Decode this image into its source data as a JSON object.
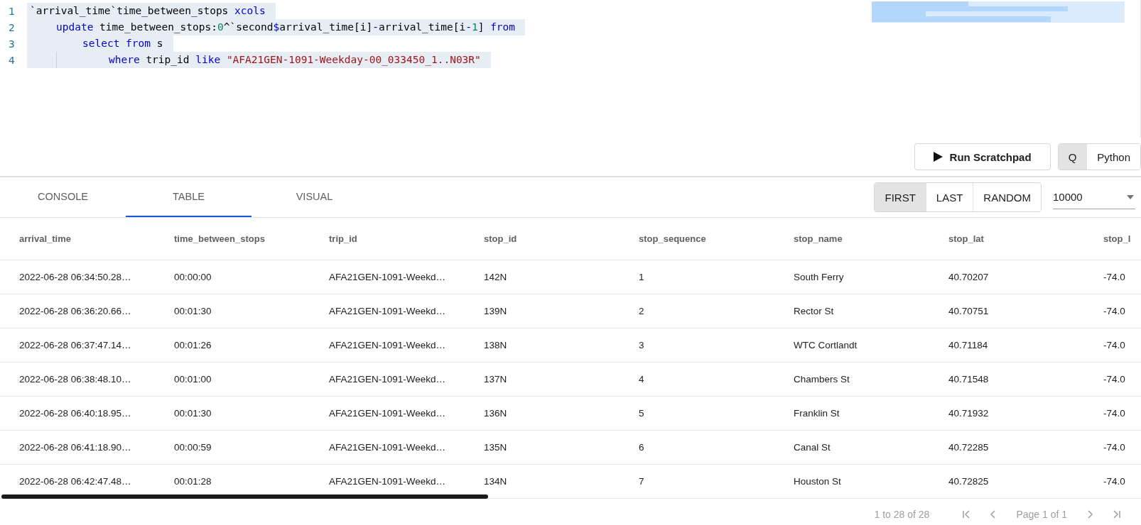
{
  "editor": {
    "lines": [
      {
        "number": "1",
        "tokens": [
          {
            "kind": "plain",
            "text": "`arrival_time`time_between_stops "
          },
          {
            "kind": "keyword",
            "text": "xcols"
          }
        ],
        "children": [
          {
            "number": "2",
            "tokens": [
              {
                "kind": "keyword",
                "text": "update "
              },
              {
                "kind": "plain",
                "text": "time_between_stops:"
              },
              {
                "kind": "number",
                "text": "0"
              },
              {
                "kind": "plain",
                "text": "^`second"
              },
              {
                "kind": "keyword",
                "text": "$"
              },
              {
                "kind": "plain",
                "text": "arrival_time[i]"
              },
              {
                "kind": "keyword",
                "text": "-"
              },
              {
                "kind": "plain",
                "text": "arrival_time[i"
              },
              {
                "kind": "keyword",
                "text": "-"
              },
              {
                "kind": "number",
                "text": "1"
              },
              {
                "kind": "plain",
                "text": "] "
              },
              {
                "kind": "keyword",
                "text": "from"
              }
            ],
            "children": [
              {
                "number": "3",
                "tokens": [
                  {
                    "kind": "keyword",
                    "text": "select from "
                  },
                  {
                    "kind": "plain",
                    "text": "s"
                  }
                ],
                "children": [
                  {
                    "number": "4",
                    "tokens": [
                      {
                        "kind": "keyword",
                        "text": "where "
                      },
                      {
                        "kind": "plain",
                        "text": "trip_id "
                      },
                      {
                        "kind": "keyword",
                        "text": "like "
                      },
                      {
                        "kind": "string",
                        "text": "\"AFA21GEN-1091-Weekday-00_033450_1..N03R\""
                      }
                    ]
                  }
                ]
              }
            ]
          }
        ]
      }
    ]
  },
  "run_button": {
    "label": "Run Scratchpad"
  },
  "languages": [
    {
      "label": "Q",
      "selected": true
    },
    {
      "label": "Python",
      "selected": false
    }
  ],
  "tabs": [
    {
      "label": "CONSOLE",
      "selected": false
    },
    {
      "label": "TABLE",
      "selected": true
    },
    {
      "label": "VISUAL",
      "selected": false
    }
  ],
  "sample_modes": [
    {
      "label": "FIRST",
      "selected": true
    },
    {
      "label": "LAST",
      "selected": false
    },
    {
      "label": "RANDOM",
      "selected": false
    }
  ],
  "row_limit": {
    "value": "10000"
  },
  "table": {
    "columns": [
      "arrival_time",
      "time_between_stops",
      "trip_id",
      "stop_id",
      "stop_sequence",
      "stop_name",
      "stop_lat",
      "stop_l"
    ],
    "rows": [
      [
        "2022-06-28 06:34:50.28…",
        "00:00:00",
        "AFA21GEN-1091-Weekd…",
        "142N",
        "1",
        "South Ferry",
        "40.70207",
        "-74.0"
      ],
      [
        "2022-06-28 06:36:20.66…",
        "00:01:30",
        "AFA21GEN-1091-Weekd…",
        "139N",
        "2",
        "Rector St",
        "40.70751",
        "-74.0"
      ],
      [
        "2022-06-28 06:37:47.14…",
        "00:01:26",
        "AFA21GEN-1091-Weekd…",
        "138N",
        "3",
        "WTC Cortlandt",
        "40.71184",
        "-74.0"
      ],
      [
        "2022-06-28 06:38:48.10…",
        "00:01:00",
        "AFA21GEN-1091-Weekd…",
        "137N",
        "4",
        "Chambers St",
        "40.71548",
        "-74.0"
      ],
      [
        "2022-06-28 06:40:18.95…",
        "00:01:30",
        "AFA21GEN-1091-Weekd…",
        "136N",
        "5",
        "Franklin St",
        "40.71932",
        "-74.0"
      ],
      [
        "2022-06-28 06:41:18.90…",
        "00:00:59",
        "AFA21GEN-1091-Weekd…",
        "135N",
        "6",
        "Canal St",
        "40.72285",
        "-74.0"
      ],
      [
        "2022-06-28 06:42:47.48…",
        "00:01:28",
        "AFA21GEN-1091-Weekd…",
        "134N",
        "7",
        "Houston St",
        "40.72825",
        "-74.0"
      ]
    ]
  },
  "pagination": {
    "range": "1 to 28 of 28",
    "page": "Page 1 of 1"
  }
}
